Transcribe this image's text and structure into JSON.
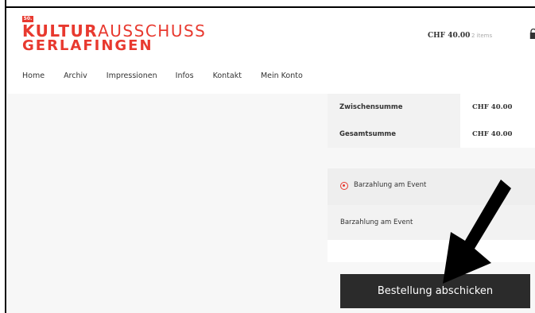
{
  "logo": {
    "badge": "50.",
    "line1_bold": "KULTUR",
    "line1_thin": "AUSSCHUSS",
    "line2": "GERLAFINGEN"
  },
  "cart": {
    "total": "CHF 40.00",
    "count": "2 items",
    "icon": "cart-bag-icon"
  },
  "nav": {
    "items": [
      "Home",
      "Archiv",
      "Impressionen",
      "Infos",
      "Kontakt",
      "Mein Konto"
    ]
  },
  "totals": {
    "rows": [
      {
        "label": "Zwischensumme",
        "value": "CHF 40.00"
      },
      {
        "label": "Gesamtsumme",
        "value": "CHF 40.00"
      }
    ]
  },
  "payment": {
    "option_label": "Barzahlung am Event",
    "description": "Barzahlung am Event"
  },
  "submit": {
    "label": "Bestellung abschicken"
  },
  "colors": {
    "accent": "#e8392f",
    "button": "#2b2b2b",
    "arrow": "#000000"
  }
}
